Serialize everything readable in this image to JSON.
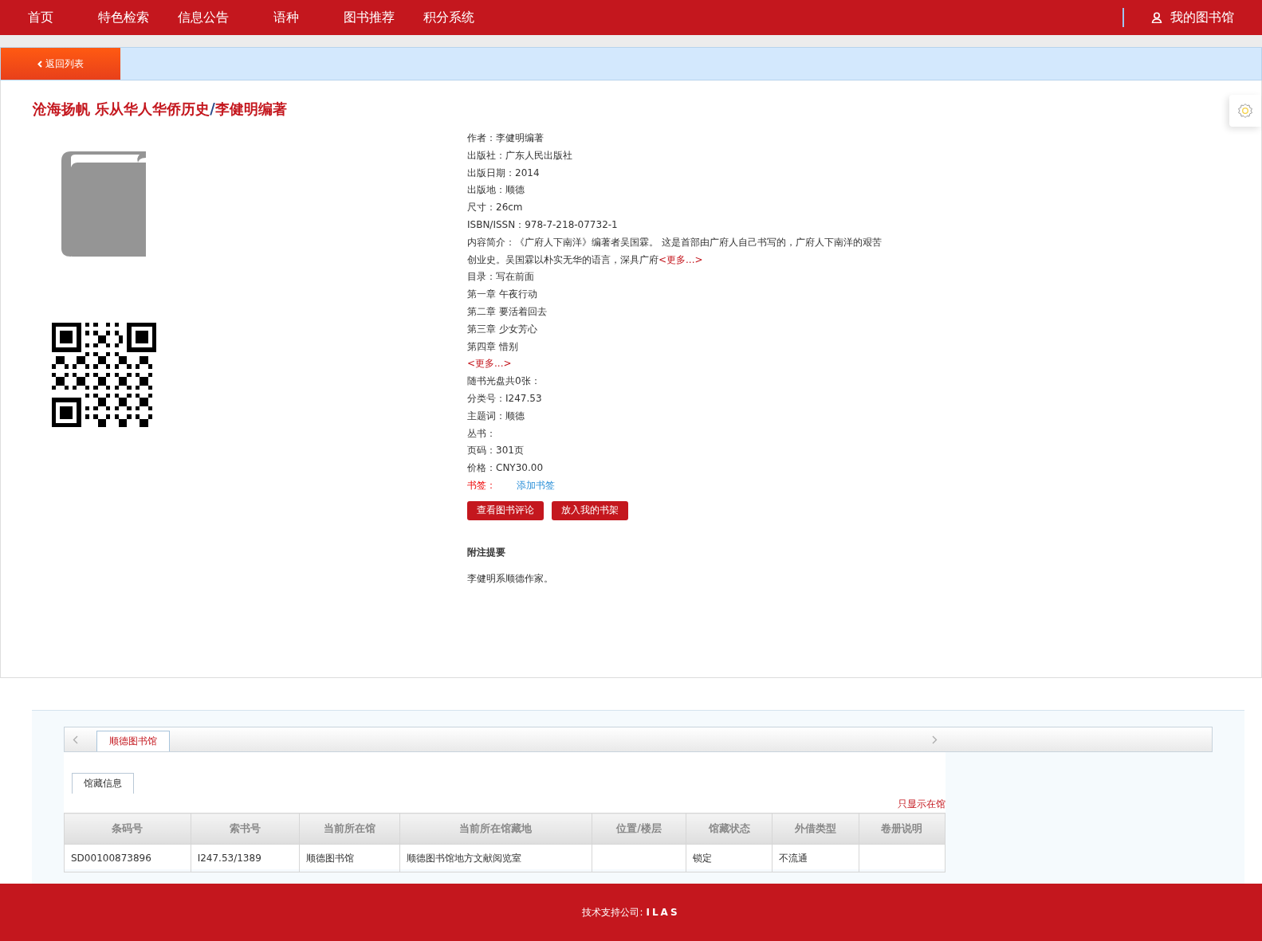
{
  "nav": {
    "items": [
      {
        "label": "首页"
      },
      {
        "label": "特色检索"
      },
      {
        "label": "信息公告"
      },
      {
        "label": "语种"
      },
      {
        "label": "图书推荐"
      },
      {
        "label": "积分系统"
      }
    ],
    "account": "我的图书馆"
  },
  "back_button": "返回列表",
  "title": {
    "main": "沧海扬帆 乐从华人华侨历史",
    "separator": "/",
    "author": "李健明编著"
  },
  "details": [
    {
      "kind": "field",
      "label": "作者：",
      "value": "李健明编著"
    },
    {
      "kind": "field",
      "label": "出版社：",
      "value": "广东人民出版社"
    },
    {
      "kind": "field",
      "label": "出版日期：",
      "value": "2014"
    },
    {
      "kind": "field",
      "label": "出版地：",
      "value": "顺德"
    },
    {
      "kind": "field",
      "label": "尺寸：",
      "value": "26cm"
    },
    {
      "kind": "field",
      "label": "ISBN/ISSN：",
      "value": "978-7-218-07732-1"
    },
    {
      "kind": "summary",
      "label": "内容简介：",
      "value": "《广府人下南洋》编著者吴国霖。 这是首部由广府人自己书写的，广府人下南洋的艰苦创业史。吴国霖以朴实无华的语言，深具广府",
      "more": "<更多...>"
    },
    {
      "kind": "field",
      "label": "目录：",
      "value": "写在前面"
    },
    {
      "kind": "line",
      "value": "第一章 午夜行动"
    },
    {
      "kind": "line",
      "value": "第二章 要活着回去"
    },
    {
      "kind": "line",
      "value": "第三章 少女芳心"
    },
    {
      "kind": "line",
      "value": "第四章 惜别"
    },
    {
      "kind": "more",
      "more": "<更多...>"
    },
    {
      "kind": "line",
      "value": "随书光盘共0张："
    },
    {
      "kind": "field",
      "label": "分类号：",
      "value": "I247.53"
    },
    {
      "kind": "field",
      "label": "主题词：",
      "value": "顺德"
    },
    {
      "kind": "field",
      "label": "丛书："
    },
    {
      "kind": "field",
      "label": "页码：",
      "value": "301页"
    },
    {
      "kind": "field",
      "label": "价格：",
      "value": "CNY30.00"
    },
    {
      "kind": "bookmark",
      "label": "书签：",
      "link": "添加书签"
    }
  ],
  "actions": [
    "查看图书评论",
    "放入我的书架"
  ],
  "notes": {
    "heading": "附注提要",
    "text": "李健明系顺德作家。"
  },
  "holdings": {
    "library_tabs": [
      {
        "label": "顺德图书馆",
        "selected": true
      }
    ],
    "sub_tabs": [
      {
        "label": "馆藏信息",
        "selected": true
      }
    ],
    "filter_link": "只显示在馆",
    "table": {
      "columns": [
        "条码号",
        "索书号",
        "当前所在馆",
        "当前所在馆藏地",
        "位置/楼层",
        "馆藏状态",
        "外借类型",
        "卷册说明"
      ],
      "rows": [
        [
          "SD00100873896",
          "I247.53/1389",
          "顺德图书馆",
          "顺德图书馆地方文献阅览室",
          null,
          "锁定",
          "不流通",
          null
        ]
      ]
    }
  },
  "footer": {
    "label": "技术支持公司:",
    "company": "ILAS"
  }
}
